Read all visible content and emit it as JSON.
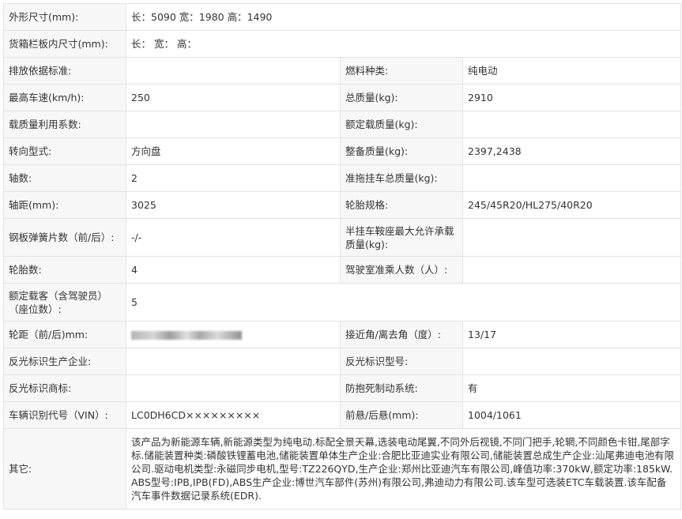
{
  "rows": {
    "dims": {
      "label": "外形尺寸(mm):",
      "value": "长：5090 宽：1980 高：1490"
    },
    "cargo": {
      "label": "货箱栏板内尺寸(mm):",
      "value": "长：  宽：  高："
    },
    "emission": {
      "label": "排放依据标准:",
      "value": "",
      "label2": "燃料种类:",
      "value2": "纯电动"
    },
    "speed": {
      "label": "最高车速(km/h):",
      "value": "250",
      "label2": "总质量(kg):",
      "value2": "2910"
    },
    "load_coef": {
      "label": "载质量利用系数:",
      "value": "",
      "label2": "额定载质量(kg):",
      "value2": ""
    },
    "steering": {
      "label": "转向型式:",
      "value": "方向盘",
      "label2": "整备质量(kg):",
      "value2": "2397,2438"
    },
    "axles": {
      "label": "轴数:",
      "value": "2",
      "label2": "准拖挂车总质量(kg):",
      "value2": ""
    },
    "wheelbase": {
      "label": "轴距(mm):",
      "value": "3025",
      "label2": "轮胎规格:",
      "value2": "245/45R20/HL275/40R20"
    },
    "springs": {
      "label": "钢板弹簧片数（前/后）:",
      "value": "-/-",
      "label2": "半挂车鞍座最大允许承载质量(kg):",
      "value2": ""
    },
    "tires": {
      "label": "轮胎数:",
      "value": "4",
      "label2": "驾驶室准乘人数（人）:",
      "value2": ""
    },
    "seats": {
      "label": "额定载客（含驾驶员）（座位数）:",
      "value": "5"
    },
    "track": {
      "label": "轮距（前/后)mm:",
      "value": "",
      "label2": "接近角/离去角（度）:",
      "value2": "13/17"
    },
    "reflect_mfr": {
      "label": "反光标识生产企业:",
      "value": "",
      "label2": "反光标识型号:",
      "value2": ""
    },
    "reflect_brand": {
      "label": "反光标识商标:",
      "value": "",
      "label2": "防抱死制动系统:",
      "value2": "有"
    },
    "vin": {
      "label": "车辆识别代号（VIN）:",
      "value": "LC0DH6CD×××××××××",
      "label2": "前悬/后悬(mm):",
      "value2": "1004/1061"
    },
    "other": {
      "label": "其它:",
      "value": "该产品为新能源车辆,新能源类型为纯电动.标配全景天幕,选装电动尾翼,不同外后视镜,不同门把手,轮辋,不同颜色卡钳,尾部字标.储能装置种类:磷酸铁锂蓄电池,储能装置单体生产企业:合肥比亚迪实业有限公司,储能装置总成生产企业:汕尾弗迪电池有限公司.驱动电机类型:永磁同步电机,型号:TZ226QYD,生产企业:郑州比亚迪汽车有限公司,峰值功率:370kW,额定功率:185kW.ABS型号:IPB,IPB(FD),ABS生产企业:博世汽车部件(苏州)有限公司,弗迪动力有限公司.该车型可选装ETC车载装置.该车配备汽车事件数据记录系统(EDR)."
    }
  }
}
